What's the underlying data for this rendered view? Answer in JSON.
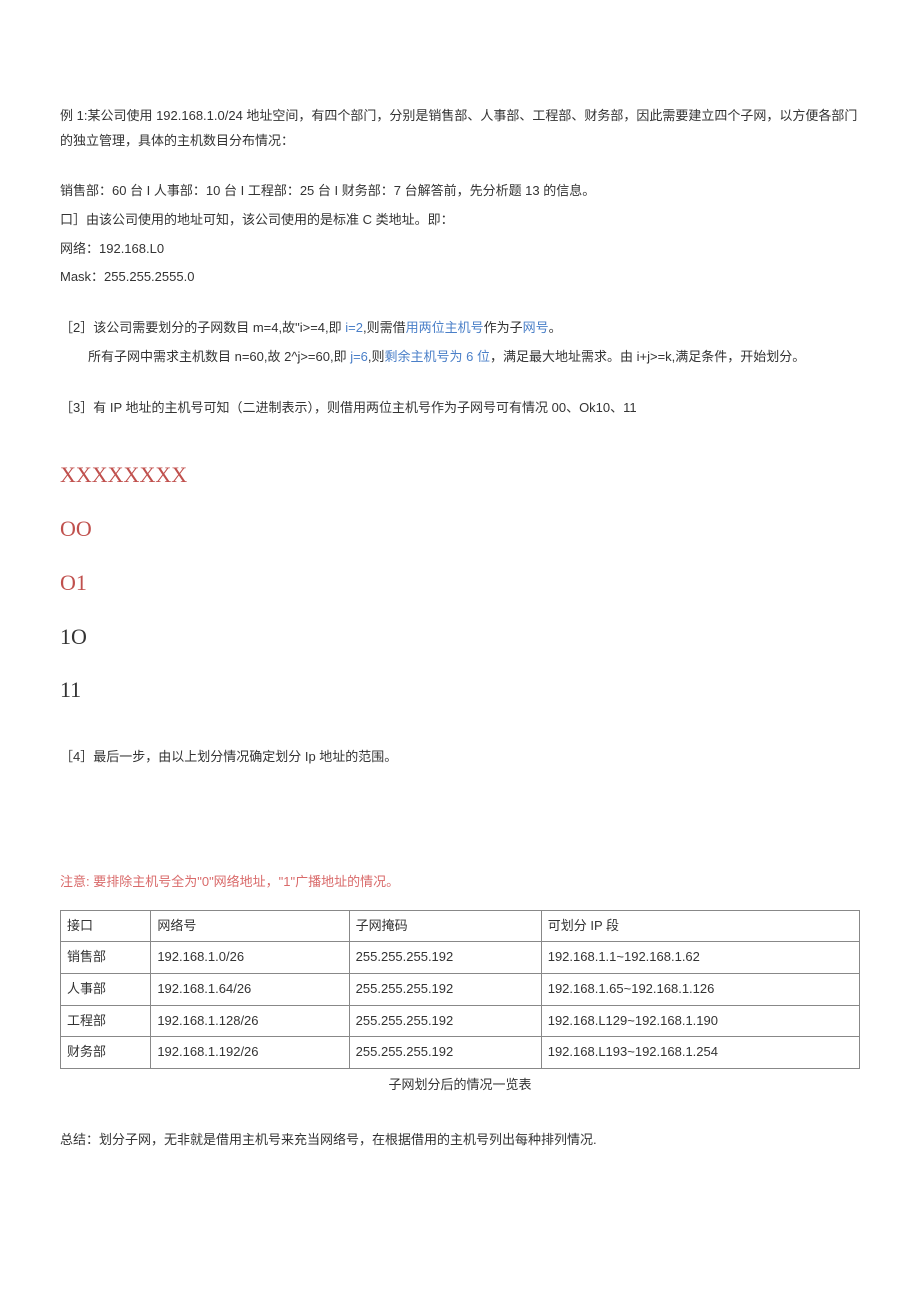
{
  "p1": "例 1:某公司使用 192.168.1.0/24 地址空间，有四个部门，分别是销售部、人事部、工程部、财务部，因此需要建立四个子网，以方便各部门的独立管理，具体的主机数目分布情况：",
  "p2": "销售部：60 台 I 人事部：10 台 I 工程部：25 台 I 财务部：7 台解答前，先分析题 13 的信息。",
  "p3": "口］由该公司使用的地址可知，该公司使用的是标准 C 类地址。即：",
  "p4": "网络：192.168.L0",
  "p5": "Mask：255.255.2555.0",
  "p6a": "［2］该公司需要划分的子网数目 m=4,故\"i>=4,即 ",
  "p6b": "i=2",
  "p6c": ",则需借",
  "p6d": "用两位主机号",
  "p6e": "作为子",
  "p6f": "网号",
  "p6g": "。",
  "p7a": "所有子网中需求主机数目 n=60,故 2^j>=60,即 ",
  "p7b": "j=6",
  "p7c": ",则",
  "p7d": "剩余主机号为 6 位",
  "p7e": "，满足最大地址需求。由 i+j>=k,满足条件，开始划分。",
  "p8": "［3］有 IP 地址的主机号可知（二进制表示），则借用两位主机号作为子网号可有情况 00、Ok10、11",
  "xxx": "XXXXXXXX",
  "b00": "OO",
  "b01": "O1",
  "b10": "1O",
  "b11": "11",
  "p9": "［4］最后一步，由以上划分情况确定划分 Ip 地址的范围。",
  "note": "注意: 要排除主机号全为\"0\"网络地址，\"1\"广播地址的情况。",
  "table": {
    "headers": [
      "接口",
      "网络号",
      "子网掩码",
      "可划分 IP 段"
    ],
    "rows": [
      [
        "销售部",
        "192.168.1.0/26",
        "255.255.255.192",
        "192.168.1.1~192.168.1.62"
      ],
      [
        "人事部",
        "192.168.1.64/26",
        "255.255.255.192",
        "192.168.1.65~192.168.1.126"
      ],
      [
        "工程部",
        "192.168.1.128/26",
        "255.255.255.192",
        "192.168.L129~192.168.1.190"
      ],
      [
        "财务部",
        "192.168.1.192/26",
        "255.255.255.192",
        "192.168.L193~192.168.1.254"
      ]
    ]
  },
  "caption": "子网划分后的情况一览表",
  "summary": "总结：划分子网，无非就是借用主机号来充当网络号，在根据借用的主机号列出每种排列情况."
}
